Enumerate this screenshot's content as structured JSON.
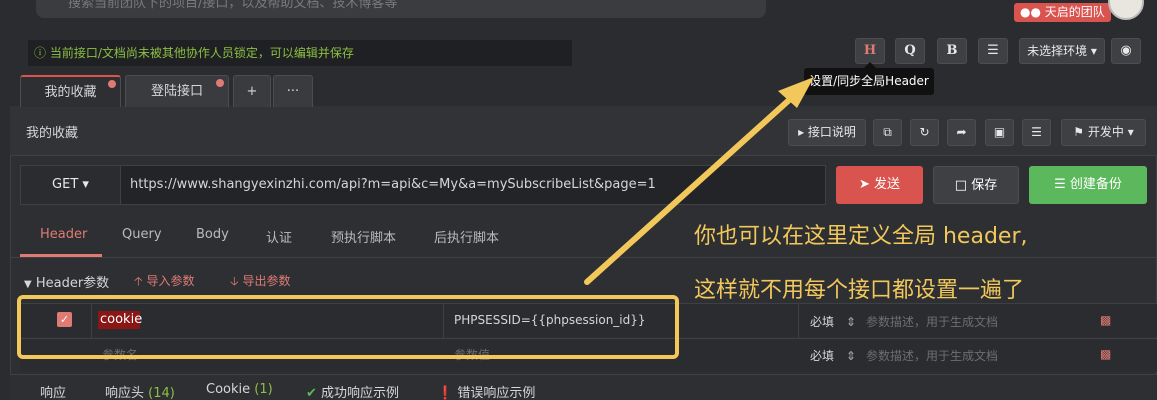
{
  "header": {
    "search_placeholder": "搜索当前团队下的项目/接口，以及帮助文档、技术博客等",
    "team_label": "天启的团队"
  },
  "notice": "当前接口/文档尚未被其他协作人员锁定，可以编辑并保存",
  "toolbar": {
    "h_label": "H",
    "q_label": "Q",
    "b_label": "B",
    "env_label": "未选择环境",
    "tooltip": "设置/同步全局Header"
  },
  "tabs": [
    {
      "label": "我的收藏"
    },
    {
      "label": "登陆接口"
    },
    {
      "label": "+"
    },
    {
      "label": "···"
    }
  ],
  "page_title": "我的收藏",
  "actions": {
    "doc_label": "接口说明",
    "dev_label": "开发中"
  },
  "request": {
    "method": "GET",
    "url": "https://www.shangyexinzhi.com/api?m=api&c=My&a=mySubscribeList&page=1",
    "send_label": "发送",
    "save_label": "保存",
    "backup_label": "创建备份"
  },
  "sub_tabs": [
    "Header",
    "Query",
    "Body",
    "认证",
    "预执行脚本",
    "后执行脚本"
  ],
  "header_section": {
    "label": "Header参数",
    "import_label": "导入参数",
    "export_label": "导出参数"
  },
  "params": [
    {
      "name": "cookie",
      "value": "PHPSESSID={{phpsession_id}}",
      "required": "必填",
      "desc_placeholder": "参数描述，用于生成文档"
    },
    {
      "name_placeholder": "参数名",
      "value_placeholder": "参数值",
      "required": "必填",
      "desc_placeholder": "参数描述，用于生成文档"
    }
  ],
  "response_tabs": {
    "response": "响应",
    "headers": "响应头",
    "headers_count": "(14)",
    "cookie": "Cookie",
    "cookie_count": "(1)",
    "success": "成功响应示例",
    "error": "错误响应示例"
  },
  "annotation": {
    "line1": "你也可以在这里定义全局 header,",
    "line2": "这样就不用每个接口都设置一遍了",
    "color": "#f2c85b"
  }
}
